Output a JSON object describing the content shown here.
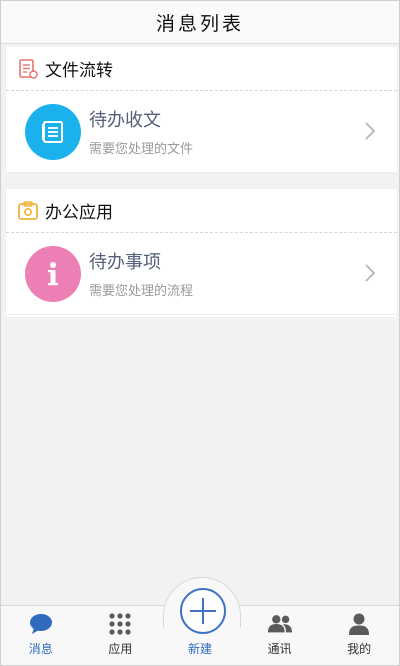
{
  "header": {
    "title": "消息列表"
  },
  "sections": [
    {
      "title": "文件流转",
      "icon": "document-icon",
      "items": [
        {
          "title": "待办收文",
          "subtitle": "需要您处理的文件",
          "icon": "list-doc-icon",
          "color": "#1ab1ec"
        }
      ]
    },
    {
      "title": "办公应用",
      "icon": "office-app-icon",
      "items": [
        {
          "title": "待办事项",
          "subtitle": "需要您处理的流程",
          "icon": "info-icon",
          "color": "#ec7fb4"
        }
      ]
    }
  ],
  "tabbar": {
    "tabs": [
      {
        "label": "消息",
        "icon": "chat-bubble-icon",
        "active": true
      },
      {
        "label": "应用",
        "icon": "grid-dots-icon"
      },
      {
        "label": "新建",
        "icon": "plus-circle-icon"
      },
      {
        "label": "通讯",
        "icon": "contacts-icon"
      },
      {
        "label": "我的",
        "icon": "user-icon"
      }
    ]
  },
  "colors": {
    "accent": "#2f6bbf",
    "blue": "#1ab1ec",
    "pink": "#ec7fb4",
    "section_icon_red": "#e8736a",
    "section_icon_orange": "#f0b33a"
  }
}
